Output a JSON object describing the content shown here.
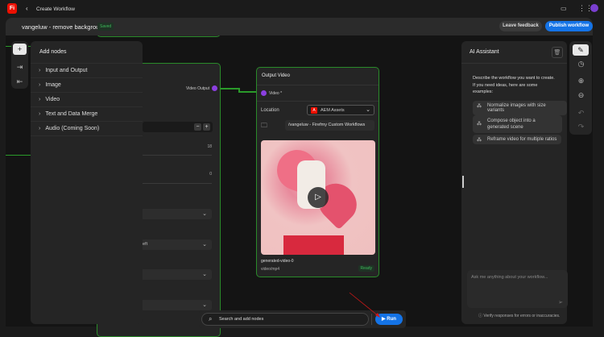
{
  "topbar": {
    "logo": "Fi",
    "back_label": "Create Workflow"
  },
  "header": {
    "title": "vangeluw - remove background",
    "status": "Saved",
    "feedback": "Leave feedback",
    "publish": "Publish workflow"
  },
  "add_nodes": {
    "title": "Add nodes",
    "items": [
      {
        "label": "Input and Output"
      },
      {
        "label": "Image"
      },
      {
        "label": "Video"
      },
      {
        "label": "Text and Data Merge"
      },
      {
        "label": "Audio (Coming Soon)"
      }
    ]
  },
  "bg_node": {
    "output_label": "Video Output",
    "value1": "18",
    "value2": "0",
    "dropdown2": "eft"
  },
  "output_node": {
    "title": "Output Video",
    "port": "Video *",
    "location_label": "Location",
    "location_value": "AEM Assets",
    "path": "/vangeluw - Firefmy Custom Workflows",
    "file_name": "generated-video-0",
    "file_type": "video/mp4",
    "status": "Ready"
  },
  "assistant": {
    "title": "AI Assistant",
    "intro": "Describe the workflow you want to create. If you need ideas, here are some examples:",
    "examples": [
      "Normalize images with size variants",
      "Compose object into a generated scene",
      "Reframe video for multiple ratios"
    ],
    "placeholder": "Ask me anything about your workflow...",
    "disclaimer": "Verify responses for errors or inaccuracies."
  },
  "bottom": {
    "search_placeholder": "Search and add nodes",
    "run": "Run"
  },
  "colors": {
    "accent": "#1473e6",
    "node_border": "#2a8a2a",
    "port": "#8b3fe0"
  }
}
